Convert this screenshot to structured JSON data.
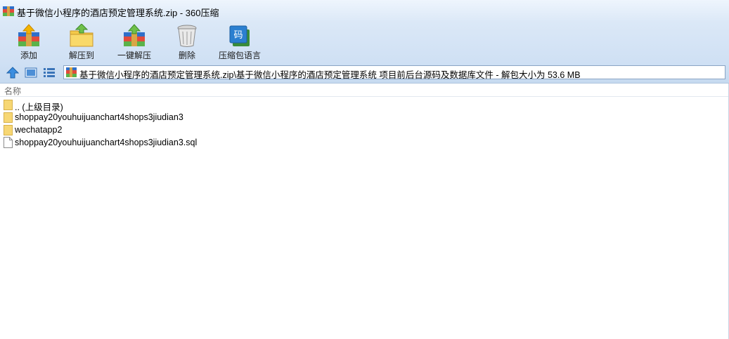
{
  "window": {
    "title": "基于微信小程序的酒店预定管理系统.zip - 360压缩",
    "app_icon": "archive-icon"
  },
  "toolbar": {
    "add_label": "添加",
    "extract_label": "解压到",
    "one_click_extract_label": "一键解压",
    "delete_label": "删除",
    "language_label": "压缩包语言"
  },
  "address_bar": {
    "path": "基于微信小程序的酒店预定管理系统.zip\\基于微信小程序的酒店预定管理系统 项目前后台源码及数据库文件 - 解包大小为 53.6 MB"
  },
  "file_list": {
    "column_name": "名称",
    "items": [
      {
        "name": ".. (上级目录)",
        "type": "folder"
      },
      {
        "name": "shoppay20youhuijuanchart4shops3jiudian3",
        "type": "folder"
      },
      {
        "name": "wechatapp2",
        "type": "folder"
      },
      {
        "name": "shoppay20youhuijuanchart4shops3jiudian3.sql",
        "type": "file"
      }
    ]
  },
  "colors": {
    "toolbar_bg": "#d3e3f5",
    "folder_yellow": "#f7d774",
    "accent_blue": "#2b7fd0"
  }
}
